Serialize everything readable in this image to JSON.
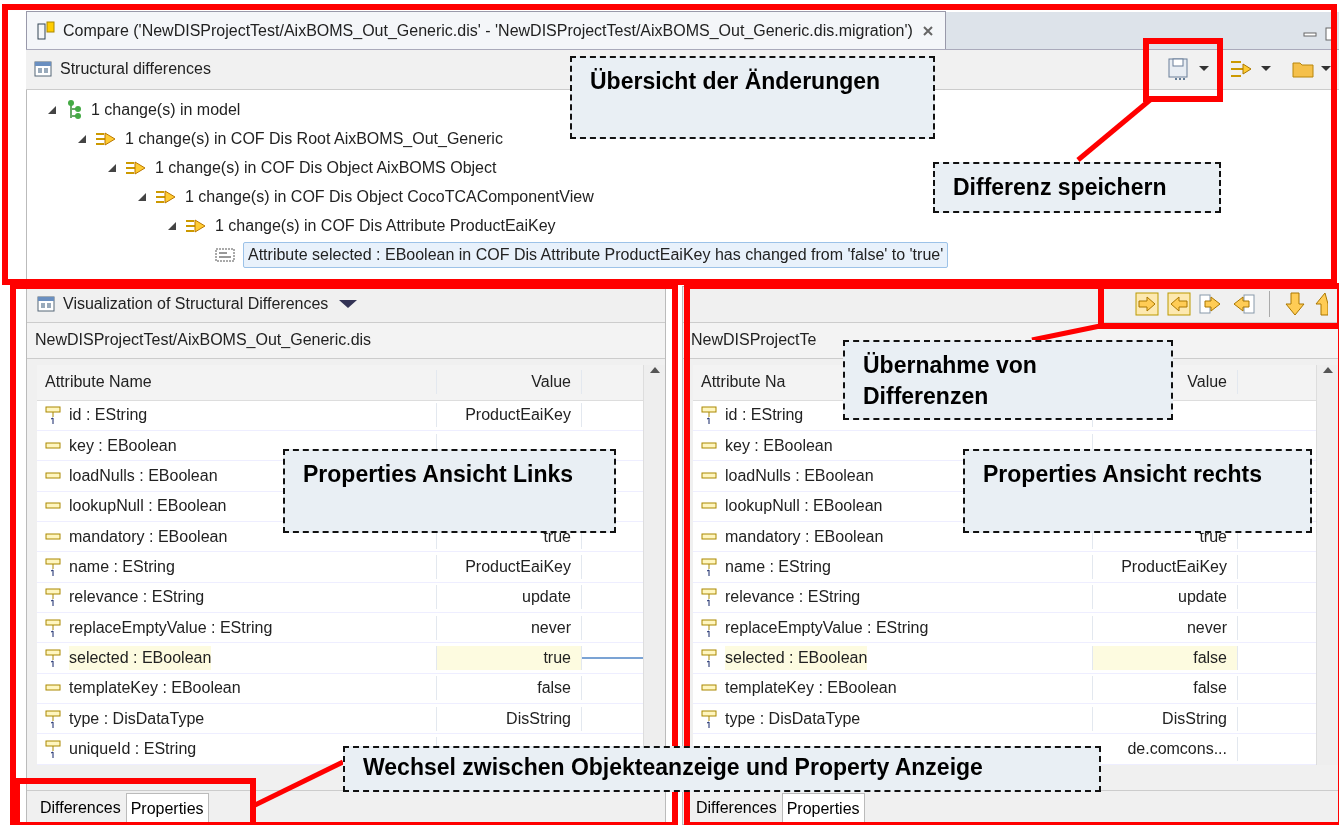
{
  "window": {
    "title": "Compare ('NewDISProjectTest/AixBOMS_Out_Generic.dis' - 'NewDISProjectTest/AixBOMS_Out_Generic.dis.migration')"
  },
  "structure_view": {
    "title": "Structural differences",
    "tree": [
      {
        "label": "1 change(s) in model",
        "kind": "model",
        "expanded": true,
        "selected": false,
        "children": [
          {
            "label": "1 change(s) in COF Dis Root AixBOMS_Out_Generic",
            "kind": "change",
            "expanded": true,
            "selected": false,
            "children": [
              {
                "label": "1 change(s) in COF Dis Object AixBOMS Object",
                "kind": "change",
                "expanded": true,
                "selected": false,
                "children": [
                  {
                    "label": "1 change(s) in COF Dis Object CocoTCAComponentView",
                    "kind": "change",
                    "expanded": true,
                    "selected": false,
                    "children": [
                      {
                        "label": "1 change(s) in COF Dis Attribute ProductEaiKey",
                        "kind": "change",
                        "expanded": true,
                        "selected": false,
                        "children": [
                          {
                            "label": "Attribute selected : EBoolean in COF Dis Attribute ProductEaiKey has changed from 'false' to 'true'",
                            "kind": "attribute",
                            "selected": true
                          }
                        ]
                      }
                    ]
                  }
                ]
              }
            ]
          }
        ]
      }
    ]
  },
  "left_pane": {
    "title": "Visualization of Structural Differences",
    "path": "NewDISProjectTest/AixBOMS_Out_Generic.dis",
    "columns": [
      "Attribute Name",
      "Value"
    ],
    "rows": [
      {
        "kind": "single",
        "name": "id : EString",
        "value": "ProductEaiKey",
        "highlighted": false
      },
      {
        "kind": "flag",
        "name": "key : EBoolean",
        "highlighted": false
      },
      {
        "kind": "flag",
        "name": "loadNulls : EBoolean",
        "highlighted": false
      },
      {
        "kind": "flag",
        "name": "lookupNull : EBoolean",
        "highlighted": false
      },
      {
        "kind": "flag",
        "name": "mandatory : EBoolean",
        "value": "true",
        "highlighted": false
      },
      {
        "kind": "single",
        "name": "name : EString",
        "value": "ProductEaiKey",
        "highlighted": false
      },
      {
        "kind": "single",
        "name": "relevance : EString",
        "value": "update",
        "highlighted": false
      },
      {
        "kind": "single",
        "name": "replaceEmptyValue : EString",
        "value": "never",
        "highlighted": false
      },
      {
        "kind": "single",
        "name": "selected : EBoolean",
        "value": "true",
        "highlighted": true
      },
      {
        "kind": "flag",
        "name": "templateKey : EBoolean",
        "value": "false",
        "highlighted": false
      },
      {
        "kind": "single",
        "name": "type : DisDataType",
        "value": "DisString",
        "highlighted": false
      },
      {
        "kind": "single",
        "name": "uniqueId : EString",
        "highlighted": false
      }
    ],
    "tabs": [
      {
        "label": "Differences",
        "selected": false
      },
      {
        "label": "Properties",
        "selected": true
      }
    ]
  },
  "right_pane": {
    "path": "NewDISProjectTe",
    "columns": [
      "Attribute Na",
      "Value"
    ],
    "rows": [
      {
        "kind": "single",
        "name": "id : EString",
        "highlighted": false
      },
      {
        "kind": "flag",
        "name": "key : EBoolean",
        "highlighted": false
      },
      {
        "kind": "flag",
        "name": "loadNulls : EBoolean",
        "highlighted": false
      },
      {
        "kind": "flag",
        "name": "lookupNull : EBoolean",
        "highlighted": false
      },
      {
        "kind": "flag",
        "name": "mandatory : EBoolean",
        "value": "true",
        "highlighted": false
      },
      {
        "kind": "single",
        "name": "name : EString",
        "value": "ProductEaiKey",
        "highlighted": false
      },
      {
        "kind": "single",
        "name": "relevance : EString",
        "value": "update",
        "highlighted": false
      },
      {
        "kind": "single",
        "name": "replaceEmptyValue : EString",
        "value": "never",
        "highlighted": false
      },
      {
        "kind": "single",
        "name": "selected : EBoolean",
        "value": "false",
        "highlighted": true
      },
      {
        "kind": "flag",
        "name": "templateKey : EBoolean",
        "value": "false",
        "highlighted": false
      },
      {
        "kind": "single",
        "name": "type : DisDataType",
        "value": "DisString",
        "highlighted": false
      },
      {
        "value": "de.comcons...",
        "highlighted": false
      }
    ],
    "tabs": [
      {
        "label": "Differences",
        "selected": false
      },
      {
        "label": "Properties",
        "selected": true
      }
    ]
  },
  "annotations": [
    {
      "text": "Übersicht der Änderungen"
    },
    {
      "text": "Differenz speichern"
    },
    {
      "text": "Übernahme von Differenzen"
    },
    {
      "text": "Properties Ansicht Links"
    },
    {
      "text": "Properties Ansicht rechts"
    },
    {
      "text": "Wechsel zwischen Objekteanzeige und Property Anzeige"
    }
  ]
}
